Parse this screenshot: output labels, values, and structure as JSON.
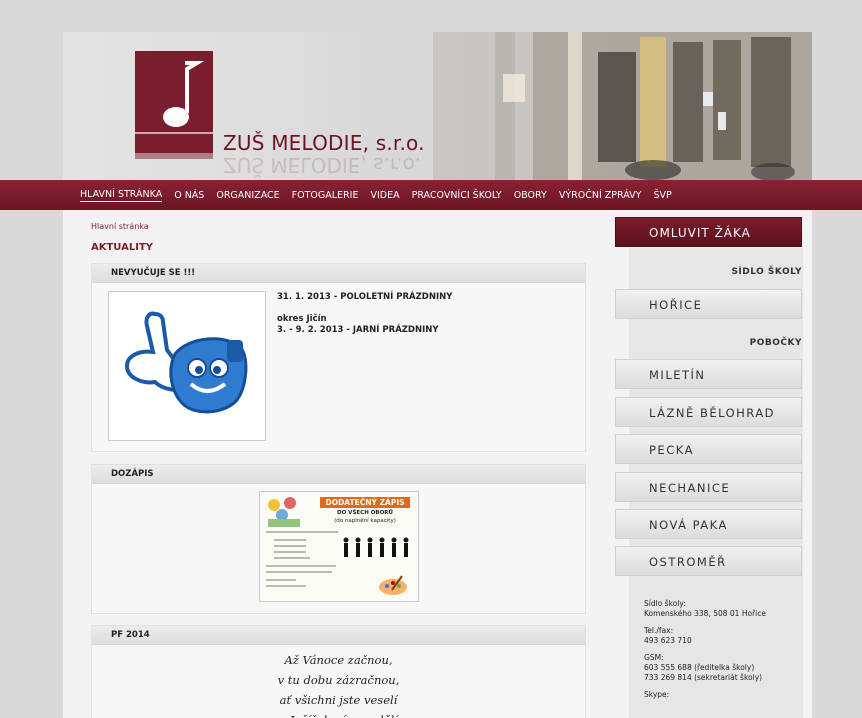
{
  "site": {
    "title": "ZUŠ MELODIE, s.r.o."
  },
  "nav": {
    "items": [
      "HLAVNÍ STRÁNKA",
      "O NÁS",
      "ORGANIZACE",
      "FOTOGALERIE",
      "VIDEA",
      "PRACOVNÍCI ŠKOLY",
      "OBORY",
      "VÝROČNÍ ZPRÁVY",
      "ŠVP"
    ]
  },
  "breadcrumb": "Hlavní stránka",
  "main": {
    "section_title": "AKTUALITY",
    "posts": [
      {
        "title": "NEVYUČUJE SE !!!",
        "lines": [
          "31. 1. 2013 - POLOLETNÍ PRÁZDNINY",
          "",
          "okres Jičín",
          "3. - 9. 2. 2013 - JARNÍ PRÁZDNINY"
        ]
      },
      {
        "title": "DOZÁPIS",
        "poster": {
          "headline": "DODATEČNÝ ZÁPIS",
          "sub1": "DO VŠECH OBORŮ",
          "sub2": "(do naplnění kapacity)"
        }
      },
      {
        "title": "PF 2014",
        "poem": [
          "Až Vánoce začnou,",
          "v tu dobu zázračnou,",
          "ať všichni jste veselí",
          "a Ježíšek vám nadělí"
        ]
      }
    ]
  },
  "sidebar": {
    "excuse_button": "OMLUVIT ŽÁKA",
    "seat_label": "SÍDLO ŠKOLY",
    "seat_item": "HOŘICE",
    "branches_label": "POBOČKY",
    "branches": [
      "MILETÍN",
      "LÁZNĚ BĚLOHRAD",
      "PECKA",
      "NECHANICE",
      "NOVÁ PAKA",
      "OSTROMĚŘ"
    ],
    "contact": {
      "seat_label": "Sídlo školy:",
      "address": "Komenského 338, 508 01 Hořice",
      "tel_label": "Tel./fax:",
      "tel": "493 623 710",
      "gsm_label": "GSM:",
      "gsm1": "603 555 688 (ředitelka školy)",
      "gsm2": "733 269 814 (sekretariát školy)",
      "skype_label": "Skype:"
    }
  },
  "colors": {
    "brand": "#7a1d2c",
    "nav": "#7c1b2b"
  }
}
